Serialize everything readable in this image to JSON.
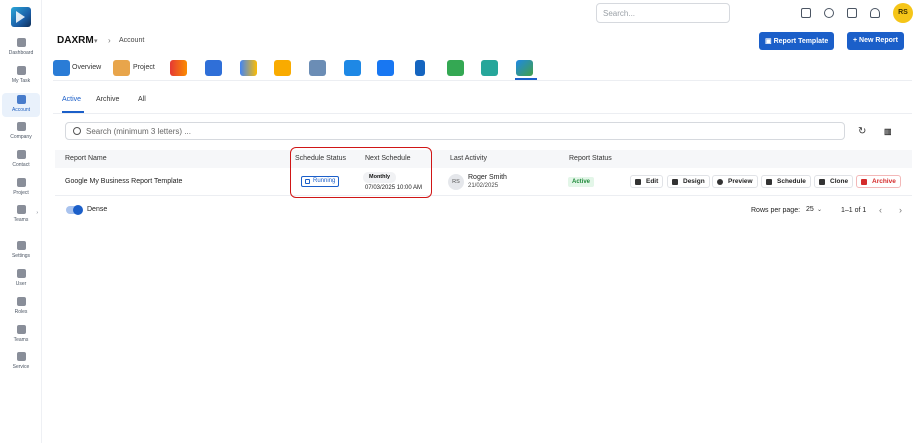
{
  "sidebar": {
    "items": [
      {
        "label": "Dashboard"
      },
      {
        "label": "My Task"
      },
      {
        "label": "Account"
      },
      {
        "label": "Company"
      },
      {
        "label": "Contact"
      },
      {
        "label": "Project"
      },
      {
        "label": "Teams"
      },
      {
        "label": "Settings"
      },
      {
        "label": "User"
      },
      {
        "label": "Roles"
      },
      {
        "label": "Teams"
      },
      {
        "label": "Service"
      }
    ]
  },
  "topbar": {
    "search_placeholder": "Search...",
    "user_initials": "RS"
  },
  "breadcrumb": {
    "org": "DAXRM",
    "page": "Account"
  },
  "header_buttons": {
    "report_template": "Report Template",
    "new_report": "+ New Report"
  },
  "integration_tabs": {
    "overview": "Overview",
    "project": "Project"
  },
  "subtabs": [
    "Active",
    "Archive",
    "All"
  ],
  "search": {
    "placeholder": "Search (minimum 3 letters) ..."
  },
  "table": {
    "headers": {
      "report_name": "Report Name",
      "schedule_status": "Schedule Status",
      "next_schedule": "Next Schedule",
      "last_activity": "Last Activity",
      "report_status": "Report Status"
    },
    "rows": [
      {
        "report_name": "Google My Business Report Template",
        "schedule_status": "Running",
        "frequency": "Monthly",
        "next_schedule": "07/03/2025 10:00 AM",
        "user_initials": "RS",
        "user_name": "Roger Smith",
        "activity_date": "21/02/2025",
        "report_status": "Active",
        "actions": [
          "Edit",
          "Design",
          "Preview",
          "Schedule",
          "Clone",
          "Archive"
        ]
      }
    ]
  },
  "footer": {
    "dense_label": "Dense",
    "rows_per_page_label": "Rows per page:",
    "rows_per_page": "25",
    "range": "1–1 of 1"
  },
  "colors": {
    "primary": "#1b5fc9",
    "highlight": "#d01616",
    "active_status": "#1f8a3a",
    "avatar": "#f5c518"
  }
}
